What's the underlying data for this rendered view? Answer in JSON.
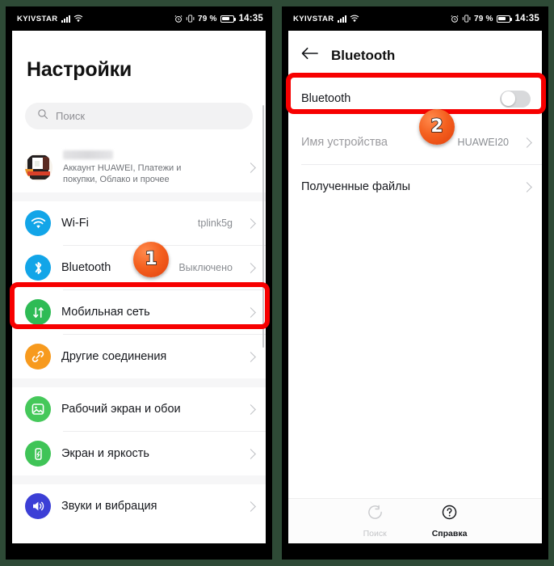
{
  "status_bar": {
    "carrier": "KYIVSTAR",
    "battery_percent": "79 %",
    "time": "14:35",
    "icons": [
      "signal-bars-icon",
      "wifi-icon",
      "alarm-icon",
      "vibrate-icon",
      "battery-icon"
    ]
  },
  "left_screen": {
    "title": "Настройки",
    "search": {
      "placeholder": "Поиск",
      "icon": "search-icon"
    },
    "account": {
      "name_redacted": "",
      "subtitle": "Аккаунт HUAWEI, Платежи и\nпокупки, Облако и прочее",
      "subtitle_line1": "Аккаунт HUAWEI, Платежи и",
      "subtitle_line2": "покупки, Облако и прочее",
      "avatar": "user-avatar"
    },
    "items": [
      {
        "label": "Wi-Fi",
        "value": "tplink5g",
        "icon": "wifi-icon",
        "color": "#12A5E8"
      },
      {
        "label": "Bluetooth",
        "value": "Выключено",
        "icon": "bluetooth-icon",
        "color": "#12A5E8"
      },
      {
        "label": "Мобильная сеть",
        "value": "",
        "icon": "mobile-network-icon",
        "color": "#2EBB55"
      },
      {
        "label": "Другие соединения",
        "value": "",
        "icon": "link-icon",
        "color": "#F79A1E"
      },
      {
        "label": "Рабочий экран и обои",
        "value": "",
        "icon": "wallpaper-icon",
        "color": "#45C85A"
      },
      {
        "label": "Экран и яркость",
        "value": "",
        "icon": "display-icon",
        "color": "#3FC457"
      },
      {
        "label": "Звуки и вибрация",
        "value": "",
        "icon": "sound-icon",
        "color": "#3C3FD6"
      }
    ]
  },
  "right_screen": {
    "appbar": {
      "title": "Bluetooth",
      "back_icon": "back-arrow-icon"
    },
    "toggle_row": {
      "label": "Bluetooth",
      "state": "off"
    },
    "rows": [
      {
        "label": "Имя устройства",
        "value": "HUAWEI20",
        "muted": true
      },
      {
        "label": "Полученные файлы",
        "value": "",
        "muted": false
      }
    ],
    "bottom_bar": [
      {
        "label": "Поиск",
        "icon": "scan-refresh-icon",
        "active": false
      },
      {
        "label": "Справка",
        "icon": "help-circle-icon",
        "active": true
      }
    ]
  },
  "annotations": {
    "highlight_color": "#f70000",
    "badges": [
      {
        "number": "1",
        "target": "bluetooth-settings-row"
      },
      {
        "number": "2",
        "target": "bluetooth-toggle-row"
      }
    ]
  }
}
